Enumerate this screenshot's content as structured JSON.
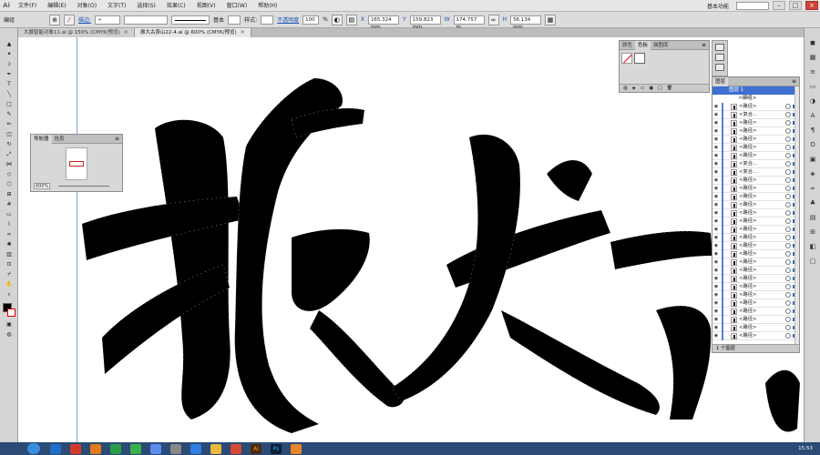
{
  "app": {
    "logo": "Ai"
  },
  "menubar": {
    "items": [
      "文件(F)",
      "编辑(E)",
      "对象(O)",
      "文字(T)",
      "选择(S)",
      "效果(C)",
      "视图(V)",
      "窗口(W)",
      "帮助(H)"
    ],
    "workspace": "基本功能"
  },
  "controlbar": {
    "mode": "编组",
    "stroke_label": "描边:",
    "stroke_style": "基本",
    "style_label": "样式:",
    "opacity_label": "不透明度",
    "opacity_value": "100",
    "opacity_unit": "%",
    "x_value": "165.324 mm",
    "y_value": "159.823 mm",
    "w_value": "174.757 m",
    "h_value": "56.134 mm"
  },
  "tabs": [
    {
      "label": "大展智能对象11.ai @ 150% (CMYK/预览)",
      "active": false
    },
    {
      "label": "振大古茶山22-4.ai @ 600% (CMYK/预览)",
      "active": true
    }
  ],
  "navigator": {
    "tabs": [
      "导航器",
      "信息"
    ],
    "zoom": "600%"
  },
  "colorpanel": {
    "tabs": [
      "颜色",
      "色板",
      "描图库"
    ]
  },
  "layers": {
    "tab": "图层",
    "layer_name": "图层 1",
    "group_name": "<编组>",
    "rows": [
      "<路径>",
      "<复合...",
      "<路径>",
      "<路径>",
      "<路径>",
      "<路径>",
      "<路径>",
      "<复合...",
      "<复合...",
      "<路径>",
      "<路径>",
      "<路径>",
      "<路径>",
      "<路径>",
      "<路径>",
      "<路径>",
      "<路径>",
      "<路径>",
      "<路径>",
      "<路径>",
      "<路径>",
      "<路径>",
      "<路径>",
      "<路径>",
      "<路径>",
      "<路径>",
      "<路径>",
      "<路径>",
      "<路径>"
    ],
    "footer": "1 个图层"
  },
  "taskbar": {
    "time": "15:53"
  },
  "colors": {
    "accent_blue": "#3f6fd0",
    "taskbar": "#2b4a75",
    "ink": "#000000"
  }
}
